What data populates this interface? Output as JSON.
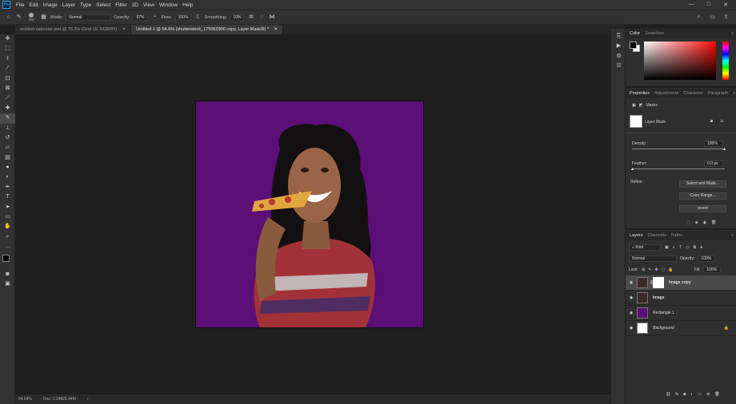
{
  "app": {
    "logo": "Ps"
  },
  "menu": [
    "File",
    "Edit",
    "Image",
    "Layer",
    "Type",
    "Select",
    "Filter",
    "3D",
    "View",
    "Window",
    "Help"
  ],
  "window_controls": [
    "—",
    "□",
    "✕"
  ],
  "options": {
    "brush_size": "225",
    "mode_label": "Mode:",
    "mode_value": "Normal",
    "opacity_label": "Opacity:",
    "opacity_value": "87%",
    "flow_label": "Flow:",
    "flow_value": "100%",
    "smoothing_label": "Smoothing:",
    "smoothing_value": "10%"
  },
  "tabs": [
    {
      "label": "october calendar.psd @ 78.3% (Grid 16, RGB/8#)",
      "active": false
    },
    {
      "label": "Untitled-1 @ 54.6% (shutterstock_175062900 copy, Layer Mask/8) *",
      "active": true
    }
  ],
  "status": {
    "zoom": "54.64%",
    "doc": "Doc: 3.34M/5.44M"
  },
  "color_panel": {
    "tabs": [
      "Color",
      "Swatches"
    ]
  },
  "properties": {
    "tabs": [
      "Properties",
      "Adjustments",
      "Character",
      "Paragraph"
    ],
    "section": "Masks",
    "mask_label": "Layer Mask",
    "density_label": "Density:",
    "density_value": "100%",
    "feather_label": "Feather:",
    "feather_value": "0.0 px",
    "refine_label": "Refine:",
    "buttons": [
      "Select and Mask...",
      "Color Range...",
      "Invert"
    ]
  },
  "layers": {
    "tabs": [
      "Layers",
      "Channels",
      "Paths"
    ],
    "kind": "Kind",
    "blend": "Normal",
    "opacity_label": "Opacity:",
    "opacity_value": "100%",
    "lock_label": "Lock:",
    "fill_label": "Fill:",
    "fill_value": "100%",
    "items": [
      {
        "name": "Image copy",
        "selected": true
      },
      {
        "name": "Image",
        "selected": false
      },
      {
        "name": "Rectangle 1",
        "selected": false
      },
      {
        "name": "Background",
        "selected": false
      }
    ]
  },
  "colors": {
    "canvas_fill": "#5b0f77",
    "accent": "#31a8ff",
    "foreground": "#000000",
    "background": "#ffffff"
  }
}
